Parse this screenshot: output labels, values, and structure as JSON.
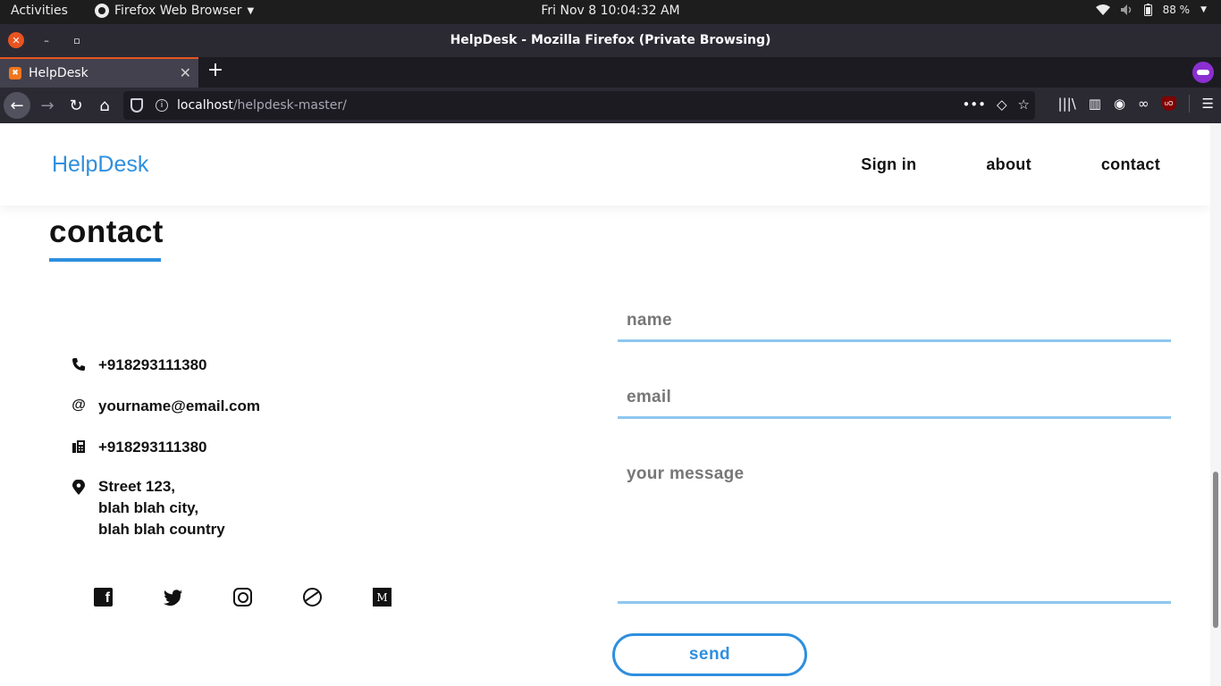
{
  "os_topbar": {
    "activities": "Activities",
    "app_menu": "Firefox Web Browser",
    "clock": "Fri Nov 8  10:04:32 AM",
    "battery": "88 %"
  },
  "window": {
    "title": "HelpDesk - Mozilla Firefox (Private Browsing)"
  },
  "tabs": [
    {
      "label": "HelpDesk",
      "active": true
    }
  ],
  "address_bar": {
    "host": "localhost",
    "path": "/helpdesk-master/"
  },
  "site": {
    "brand": "HelpDesk",
    "nav": [
      "Sign in",
      "about",
      "contact"
    ],
    "section_title": "contact",
    "contact_info": {
      "phone": "+918293111380",
      "email": "yourname@email.com",
      "fax": "+918293111380",
      "address_lines": [
        "Street 123,",
        "blah blah city,",
        "blah blah country"
      ]
    },
    "social": [
      "facebook-icon",
      "twitter-icon",
      "instagram-icon",
      "dribbble-icon",
      "medium-icon"
    ],
    "form": {
      "name_placeholder": "name",
      "email_placeholder": "email",
      "message_placeholder": "your message",
      "send_label": "send"
    }
  },
  "colors": {
    "accent": "#2f8fde",
    "field_underline": "#8fc7ef",
    "ubuntu_orange": "#e95420",
    "private_purple": "#8b2fd1"
  }
}
